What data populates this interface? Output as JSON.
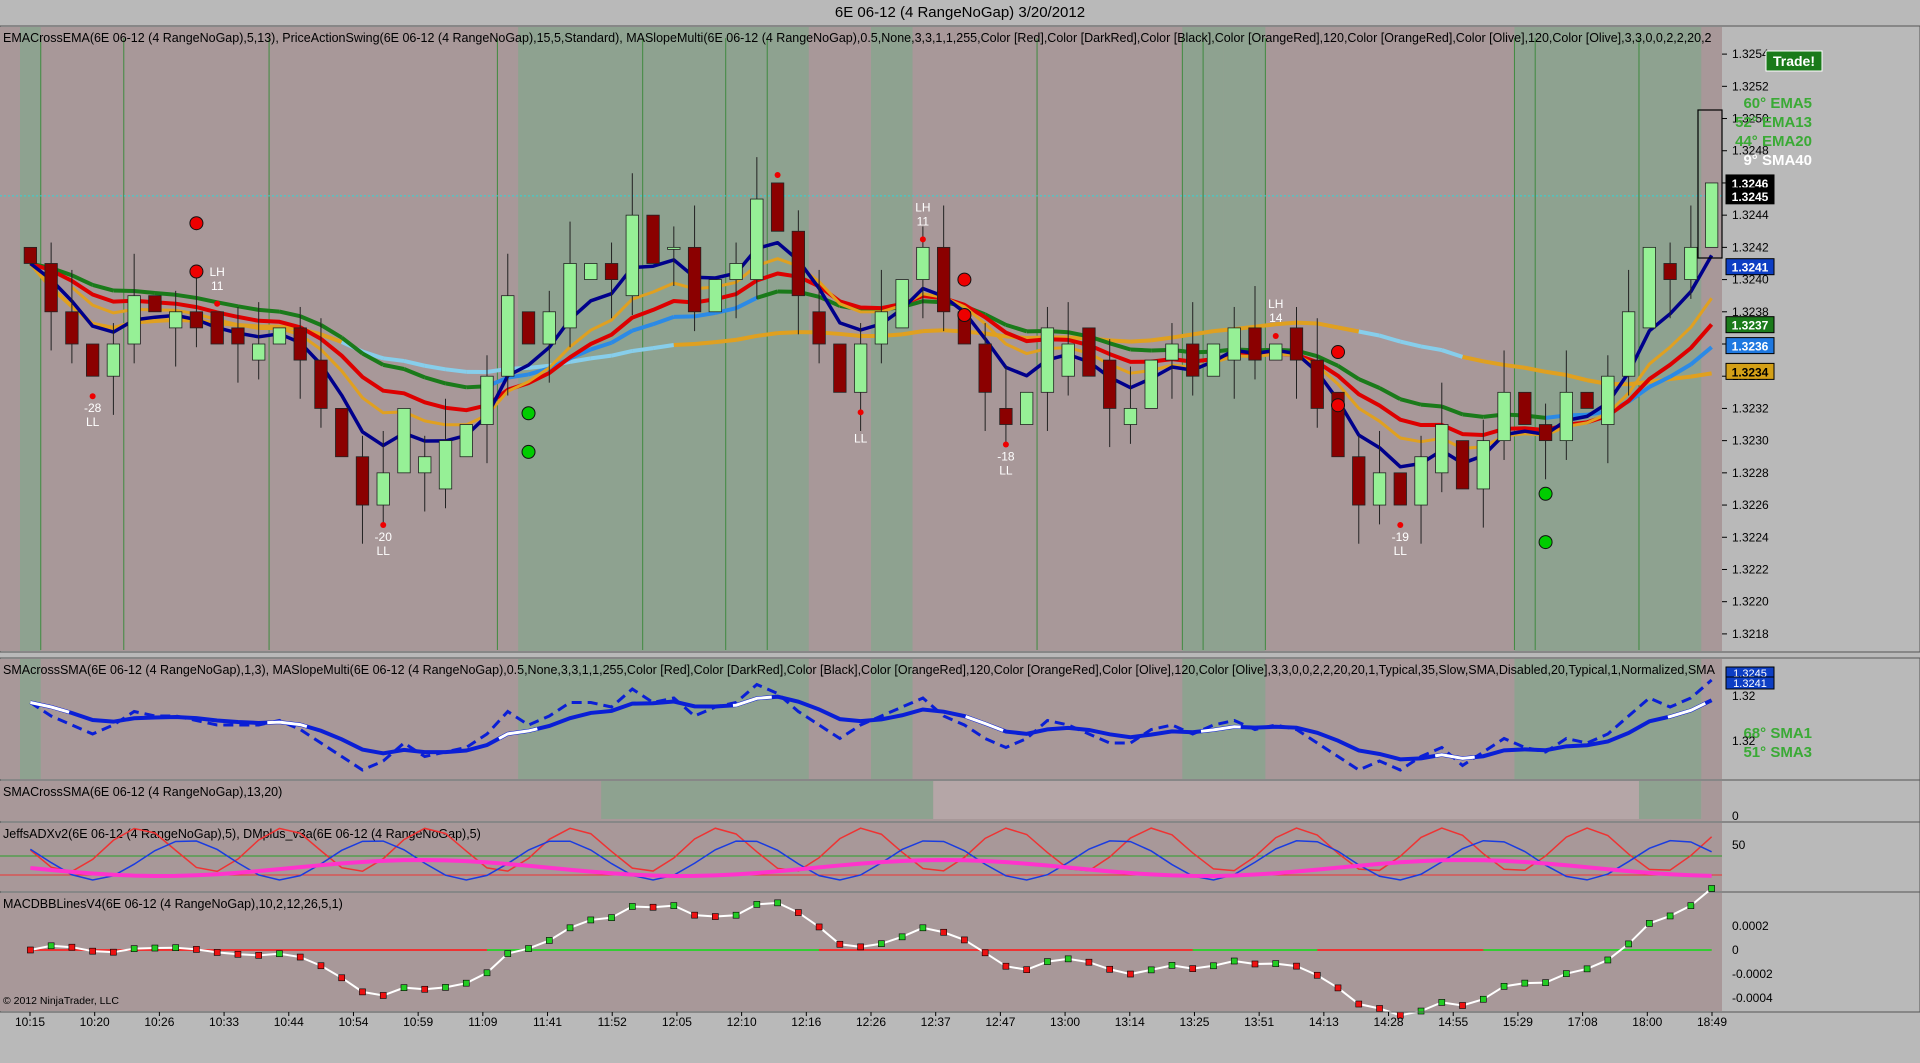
{
  "window": {
    "title": "6E 06-12 (4 RangeNoGap)  3/20/2012"
  },
  "copyright": "© 2012 NinjaTrader, LLC",
  "trade_badge": "Trade!",
  "colors": {
    "bg_red": "#a89899",
    "bg_green": "#8ea290",
    "bull": "#96f096",
    "bear": "#8b0000",
    "ema5": "#00008b",
    "ema13": "#dd0000",
    "ema20": "#1a7a1a",
    "sma40_up": "#ffaa00",
    "sma40_flat": "#87ceeb",
    "accent_green": "#3aaa35"
  },
  "panels": [
    {
      "id": "price",
      "label": "EMACrossEMA(6E 06-12 (4 RangeNoGap),5,13),  PriceActionSwing(6E 06-12 (4 RangeNoGap),15,5,Standard),  MASlopeMulti(6E 06-12 (4 RangeNoGap),0.5,None,3,3,1,1,255,Color [Red],Color [DarkRed],Color [Black],Color [OrangeRed],120,Color [OrangeRed],Color [Olive],120,Color [Olive],3,3,0,0,2,2,20,2"
    },
    {
      "id": "sma",
      "label": "SMAcrossSMA(6E 06-12 (4 RangeNoGap),1,3),  MASlopeMulti(6E 06-12 (4 RangeNoGap),0.5,None,3,3,1,1,255,Color [Red],Color [DarkRed],Color [Black],Color [OrangeRed],120,Color [OrangeRed],Color [Olive],120,Color [Olive],3,3,0,0,2,2,20,20,1,Typical,35,Slow,SMA,Disabled,20,Typical,1,Normalized,SMA"
    },
    {
      "id": "smacross",
      "label": "SMACrossSMA(6E 06-12 (4 RangeNoGap),13,20)"
    },
    {
      "id": "adx",
      "label": "JeffsADXv2(6E 06-12 (4 RangeNoGap),5),  DMplus_v3a(6E 06-12 (4 RangeNoGap),5)"
    },
    {
      "id": "macd",
      "label": "MACDBBLinesV4(6E 06-12 (4 RangeNoGap),10,2,12,26,5,1)"
    }
  ],
  "slope_legend": [
    {
      "text": "60° EMA5",
      "color": "#3aaa35"
    },
    {
      "text": "52° EMA13",
      "color": "#3aaa35"
    },
    {
      "text": "44° EMA20",
      "color": "#3aaa35"
    },
    {
      "text": "9° SMA40",
      "color": "#ffffff"
    }
  ],
  "sma_legend": [
    {
      "text": "68° SMA1",
      "color": "#3aaa35"
    },
    {
      "text": "51° SMA3",
      "color": "#3aaa35"
    }
  ],
  "price_badges": [
    {
      "text": "1.3246",
      "value": 1.3246,
      "color": "#000000"
    },
    {
      "text": "1.3245",
      "value": 1.32452,
      "color": "#000000"
    },
    {
      "text": "1.3241",
      "value": 1.32408,
      "color": "#0d3ec4"
    },
    {
      "text": "1.3237",
      "value": 1.32372,
      "color": "#1a7a1a"
    },
    {
      "text": "1.3236",
      "value": 1.32359,
      "color": "#1e78e0"
    },
    {
      "text": "1.3234",
      "value": 1.32343,
      "color": "#d4a017"
    }
  ],
  "sma_badges": [
    {
      "text": "1.3245"
    },
    {
      "text": "1.3241"
    }
  ],
  "swing_labels": [
    {
      "i": 3,
      "top": false,
      "num": "-28",
      "lab": "LL"
    },
    {
      "i": 9,
      "top": true,
      "num": "11",
      "lab": "LH"
    },
    {
      "i": 17,
      "top": false,
      "num": "-20",
      "lab": "LL"
    },
    {
      "i": 36,
      "top": true,
      "num": "",
      "lab": ""
    },
    {
      "i": 40,
      "top": false,
      "num": "",
      "lab": "LL"
    },
    {
      "i": 43,
      "top": true,
      "num": "11",
      "lab": "LH"
    },
    {
      "i": 47,
      "top": false,
      "num": "-18",
      "lab": "LL"
    },
    {
      "i": 60,
      "top": true,
      "num": "14",
      "lab": "LH"
    },
    {
      "i": 66,
      "top": false,
      "num": "-19",
      "lab": "LL"
    }
  ],
  "chart_data": {
    "type": "candlestick",
    "instrument": "6E 06-12 (4 RangeNoGap)",
    "price_axis": {
      "min": 1.3217,
      "max": 1.3255,
      "ticks": [
        "1.3254",
        "1.3252",
        "1.3250",
        "1.3248",
        "1.3246",
        "1.3244",
        "1.3242",
        "1.3240",
        "1.3238",
        "1.3236",
        "1.3234",
        "1.3232",
        "1.3230",
        "1.3228",
        "1.3226",
        "1.3224",
        "1.3222",
        "1.3220",
        "1.3218"
      ]
    },
    "sma_axis_ticks": [
      "1.32",
      "1.32"
    ],
    "smacross_axis_ticks": [
      "0"
    ],
    "adx_axis_ticks": [
      "50"
    ],
    "macd_axis_ticks": [
      "0.0002",
      "0",
      "-0.0002",
      "-0.0004"
    ],
    "time_labels": [
      "10:15",
      "10:20",
      "10:26",
      "10:33",
      "10:44",
      "10:54",
      "10:59",
      "11:09",
      "11:41",
      "11:52",
      "12:05",
      "12:10",
      "12:16",
      "12:26",
      "12:37",
      "12:47",
      "13:00",
      "13:14",
      "13:25",
      "13:51",
      "14:13",
      "14:28",
      "14:55",
      "15:29",
      "17:08",
      "18:00",
      "18:49"
    ],
    "candles": [
      [
        1.3242,
        1.3241
      ],
      [
        1.3241,
        1.3238
      ],
      [
        1.3238,
        1.3236
      ],
      [
        1.3236,
        1.3234
      ],
      [
        1.3234,
        1.3236
      ],
      [
        1.3236,
        1.3239
      ],
      [
        1.3239,
        1.3238
      ],
      [
        1.3237,
        1.3238
      ],
      [
        1.3238,
        1.3237
      ],
      [
        1.3238,
        1.3236
      ],
      [
        1.3237,
        1.3236
      ],
      [
        1.3235,
        1.3236
      ],
      [
        1.3236,
        1.3237
      ],
      [
        1.3237,
        1.3235
      ],
      [
        1.3235,
        1.3232
      ],
      [
        1.3232,
        1.3229
      ],
      [
        1.3229,
        1.3226
      ],
      [
        1.3226,
        1.3228
      ],
      [
        1.3228,
        1.3232
      ],
      [
        1.3228,
        1.3229
      ],
      [
        1.3227,
        1.323
      ],
      [
        1.3229,
        1.3231
      ],
      [
        1.3231,
        1.3234
      ],
      [
        1.3234,
        1.3239
      ],
      [
        1.3238,
        1.3236
      ],
      [
        1.3236,
        1.3238
      ],
      [
        1.3237,
        1.3241
      ],
      [
        1.324,
        1.3241
      ],
      [
        1.3241,
        1.324
      ],
      [
        1.3239,
        1.3244
      ],
      [
        1.3244,
        1.3241
      ],
      [
        1.3242,
        1.3242
      ],
      [
        1.3242,
        1.3238
      ],
      [
        1.3238,
        1.324
      ],
      [
        1.324,
        1.3241
      ],
      [
        1.324,
        1.3245
      ],
      [
        1.3246,
        1.3243
      ],
      [
        1.3243,
        1.3239
      ],
      [
        1.3238,
        1.3236
      ],
      [
        1.3236,
        1.3233
      ],
      [
        1.3233,
        1.3236
      ],
      [
        1.3236,
        1.3238
      ],
      [
        1.3237,
        1.324
      ],
      [
        1.324,
        1.3242
      ],
      [
        1.3242,
        1.3238
      ],
      [
        1.3238,
        1.3236
      ],
      [
        1.3236,
        1.3233
      ],
      [
        1.3232,
        1.3231
      ],
      [
        1.3231,
        1.3233
      ],
      [
        1.3233,
        1.3237
      ],
      [
        1.3234,
        1.3236
      ],
      [
        1.3237,
        1.3234
      ],
      [
        1.3235,
        1.3232
      ],
      [
        1.3231,
        1.3232
      ],
      [
        1.3232,
        1.3235
      ],
      [
        1.3235,
        1.3236
      ],
      [
        1.3236,
        1.3234
      ],
      [
        1.3234,
        1.3236
      ],
      [
        1.3235,
        1.3237
      ],
      [
        1.3237,
        1.3235
      ],
      [
        1.3235,
        1.3236
      ],
      [
        1.3237,
        1.3235
      ],
      [
        1.3235,
        1.3232
      ],
      [
        1.3233,
        1.3229
      ],
      [
        1.3229,
        1.3226
      ],
      [
        1.3226,
        1.3228
      ],
      [
        1.3228,
        1.3226
      ],
      [
        1.3226,
        1.3229
      ],
      [
        1.3228,
        1.3231
      ],
      [
        1.323,
        1.3227
      ],
      [
        1.3227,
        1.323
      ],
      [
        1.323,
        1.3233
      ],
      [
        1.3233,
        1.3231
      ],
      [
        1.3231,
        1.323
      ],
      [
        1.323,
        1.3233
      ],
      [
        1.3233,
        1.3232
      ],
      [
        1.3231,
        1.3234
      ],
      [
        1.3234,
        1.3238
      ],
      [
        1.3237,
        1.3242
      ],
      [
        1.3241,
        1.324
      ],
      [
        1.324,
        1.3242
      ],
      [
        1.3242,
        1.3246
      ]
    ]
  }
}
